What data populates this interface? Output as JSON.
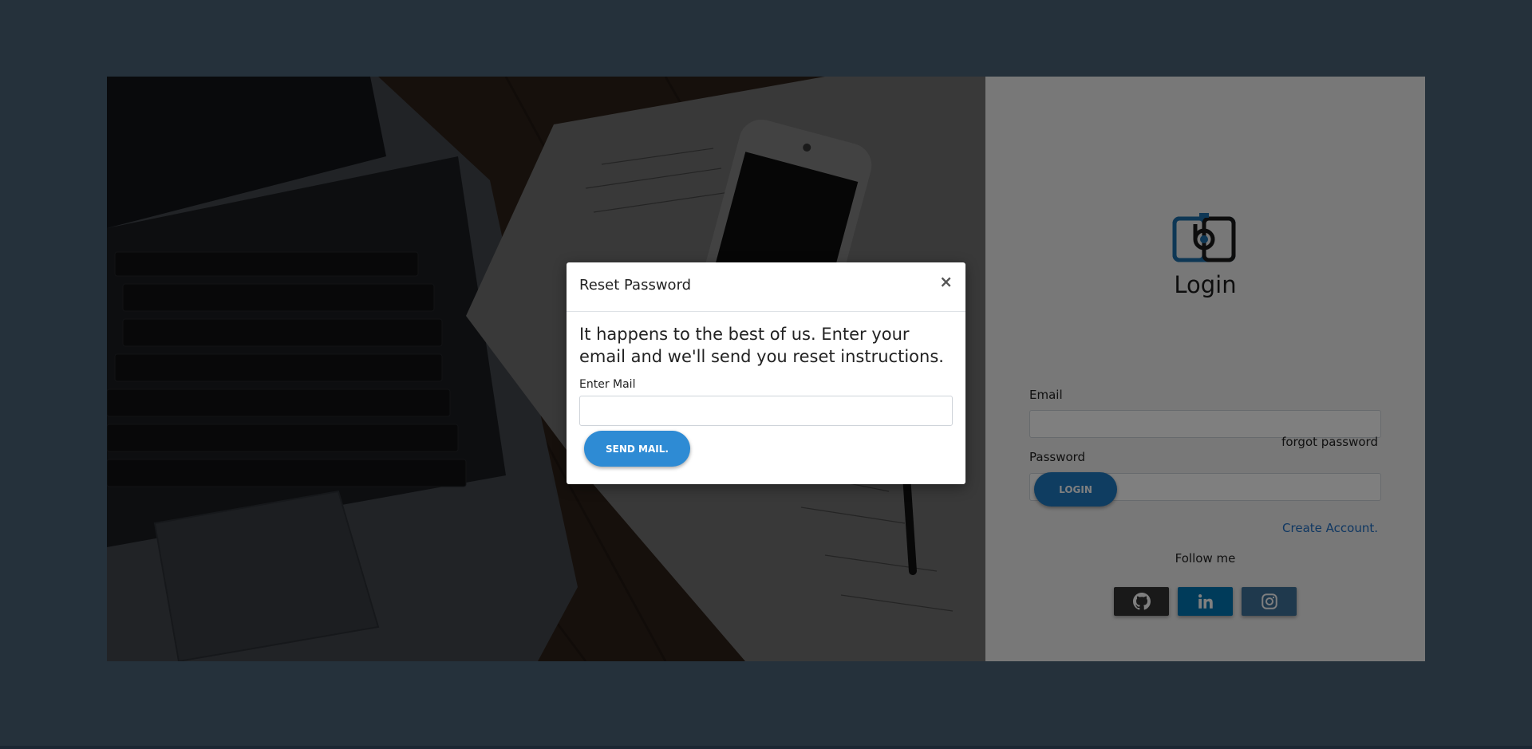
{
  "login_panel": {
    "title": "Login",
    "email_label": "Email",
    "password_label": "Password",
    "forgot_password": "forgot password",
    "login_button": "LOGIN",
    "create_account": "Create Account.",
    "follow_me": "Follow me",
    "socials": [
      "github-icon",
      "linkedin-icon",
      "instagram-icon"
    ]
  },
  "modal": {
    "title": "Reset Password",
    "close": "×",
    "message": "It happens to the best of us. Enter your email and we'll send you reset instructions.",
    "input_label": "Enter Mail",
    "send_button": "SEND MAIL."
  },
  "colors": {
    "page_background": "#4b6276",
    "primary_button": "#1f7ac3",
    "link": "#1f6fc5",
    "github": "#333333",
    "linkedin": "#0077b5",
    "instagram": "#3f729b"
  }
}
